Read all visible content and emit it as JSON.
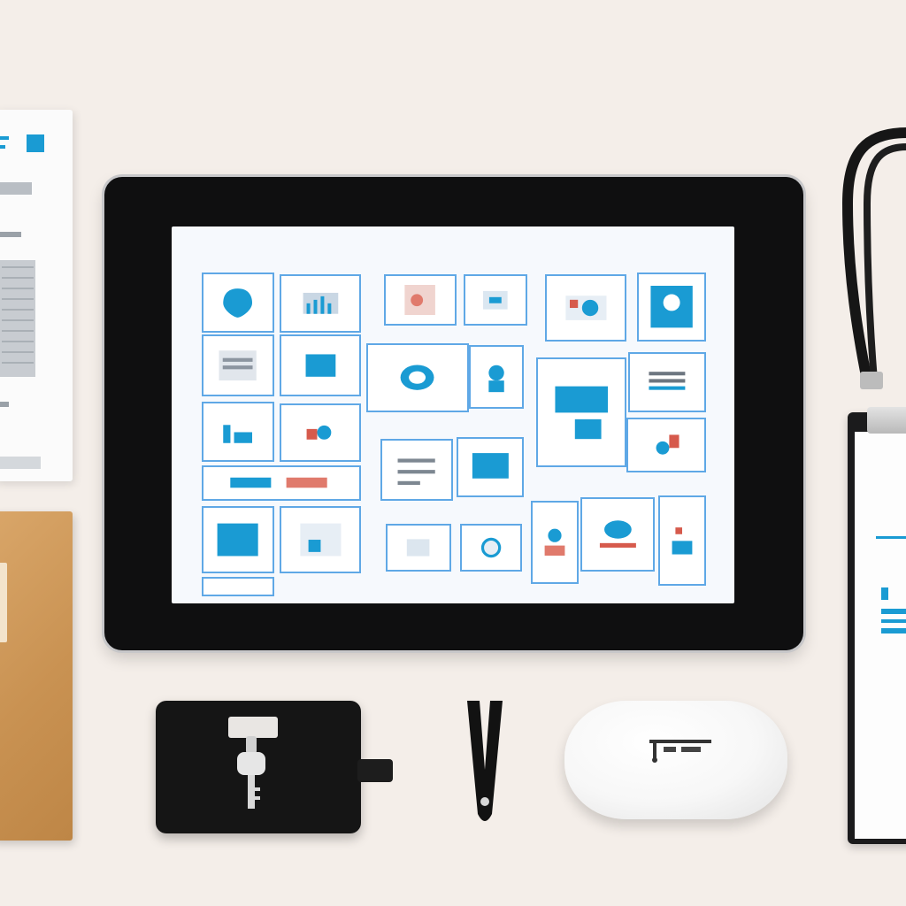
{
  "scene": {
    "description_items": [],
    "colors": {
      "background": "#f4eee9",
      "tablet_bezel": "#0f0f10",
      "tile_accent": "#5fa8e6",
      "tile_fill": "#1a9bd3",
      "cork": "#c99252"
    },
    "icons": {
      "tablet": "tablet-device",
      "wallet": "leather-key-wallet",
      "pen": "fountain-pen",
      "mouse": "wireless-mouse",
      "lanyard": "lanyard",
      "clipboard": "clipboard"
    }
  }
}
